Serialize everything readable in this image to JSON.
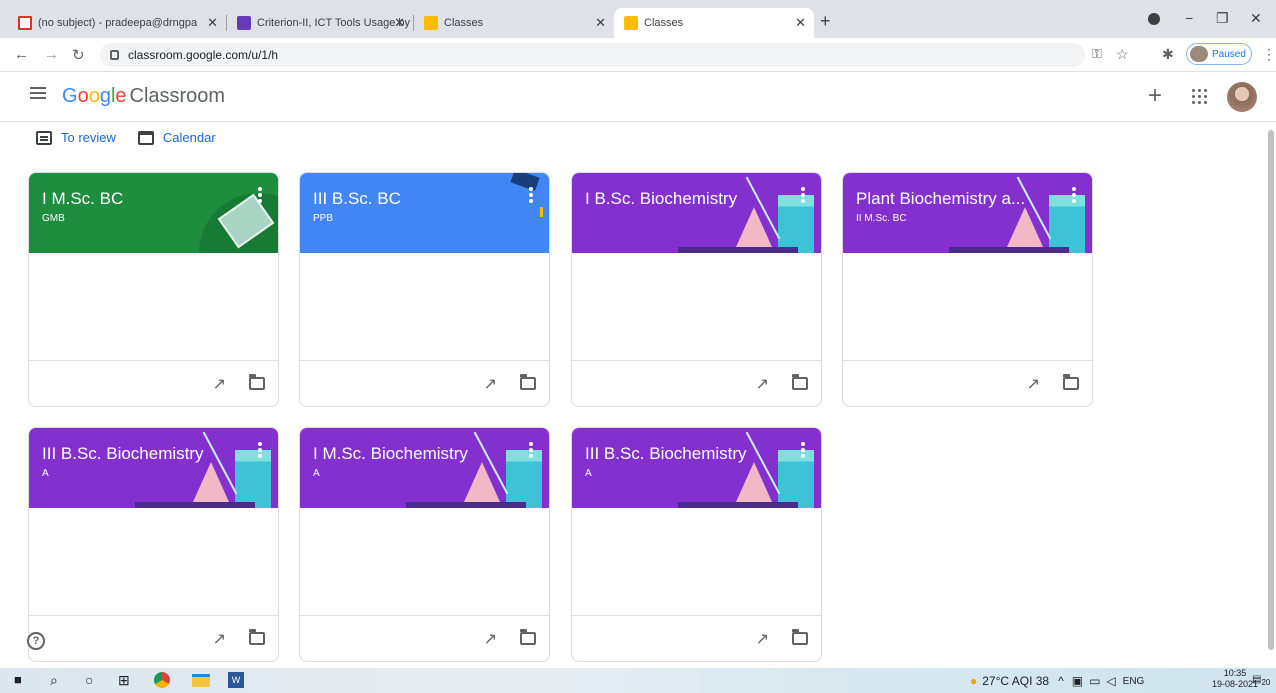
{
  "browser": {
    "tabs": [
      {
        "title": "(no subject) - pradeepa@drngpa",
        "favicon_color": "#d93025"
      },
      {
        "title": "Criterion-II, ICT Tools Usage by Te",
        "favicon_color": "#673ab7"
      },
      {
        "title": "Classes",
        "favicon_color": "#fbbc04"
      },
      {
        "title": "Classes",
        "favicon_color": "#fbbc04"
      }
    ],
    "url": "classroom.google.com/u/1/h",
    "profile_status": "Paused"
  },
  "app": {
    "logo_google": "Google",
    "logo_product": "Classroom",
    "nav": {
      "to_review": "To review",
      "calendar": "Calendar"
    }
  },
  "classes": [
    {
      "title": "I M.Sc. BC",
      "section": "GMB",
      "theme": "green",
      "color": "#1e8e3e"
    },
    {
      "title": "III B.Sc. BC",
      "section": "PPB",
      "theme": "blue",
      "color": "#4285f4"
    },
    {
      "title": "I B.Sc. Biochemistry",
      "section": "",
      "theme": "lab",
      "color": "#8430ce"
    },
    {
      "title": "Plant Biochemistry a...",
      "section": "II M.Sc. BC",
      "theme": "lab",
      "color": "#8430ce"
    },
    {
      "title": "III B.Sc. Biochemistry",
      "section": "A",
      "theme": "lab",
      "color": "#8430ce"
    },
    {
      "title": "I M.Sc. Biochemistry",
      "section": "A",
      "theme": "lab",
      "color": "#8430ce"
    },
    {
      "title": "III B.Sc. Biochemistry",
      "section": "A",
      "theme": "lab",
      "color": "#8430ce"
    }
  ],
  "taskbar": {
    "weather": "27°C AQI 38",
    "language": "ENG",
    "time": "10:35",
    "date": "19-08-2021",
    "notifications": "20"
  }
}
